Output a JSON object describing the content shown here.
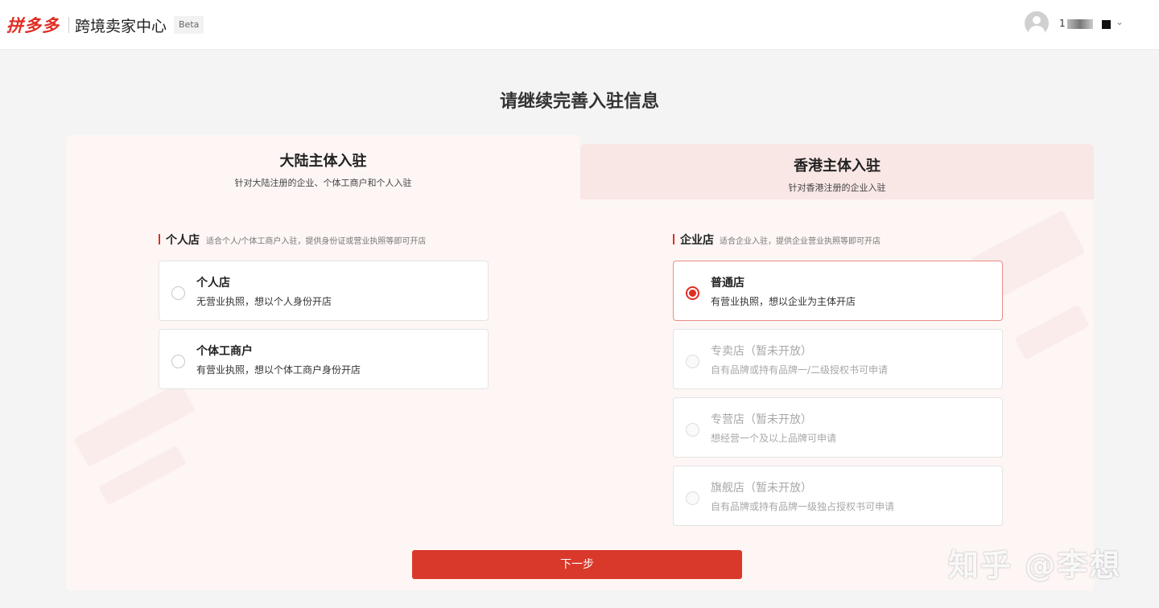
{
  "header": {
    "logo": "拼多多",
    "center_name": "跨境卖家中心",
    "beta": "Beta",
    "username": "1"
  },
  "page_title": "请继续完善入驻信息",
  "tabs": [
    {
      "title": "大陆主体入驻",
      "subtitle": "针对大陆注册的企业、个体工商户和个人入驻",
      "active": true
    },
    {
      "title": "香港主体入驻",
      "subtitle": "针对香港注册的企业入驻",
      "active": false
    }
  ],
  "personal_section": {
    "title": "个人店",
    "desc": "适合个人/个体工商户入驻，提供身份证或营业执照等即可开店",
    "options": [
      {
        "title": "个人店",
        "desc": "无营业执照，想以个人身份开店",
        "state": "unchecked"
      },
      {
        "title": "个体工商户",
        "desc": "有营业执照，想以个体工商户身份开店",
        "state": "unchecked"
      }
    ]
  },
  "enterprise_section": {
    "title": "企业店",
    "desc": "适合企业入驻，提供企业营业执照等即可开店",
    "options": [
      {
        "title": "普通店",
        "desc": "有营业执照，想以企业为主体开店",
        "state": "checked"
      },
      {
        "title": "专卖店（暂未开放）",
        "desc": "自有品牌或持有品牌一/二级授权书可申请",
        "state": "disabled"
      },
      {
        "title": "专营店（暂未开放）",
        "desc": "想经营一个及以上品牌可申请",
        "state": "disabled"
      },
      {
        "title": "旗舰店（暂未开放）",
        "desc": "自有品牌或持有品牌一级独占授权书可申请",
        "state": "disabled"
      }
    ]
  },
  "next_button": "下一步",
  "watermark": "知乎 @李想",
  "colors": {
    "accent": "#e02e24",
    "panel_bg": "#fdf6f5",
    "tab_inactive_bg": "#f9e7e5"
  }
}
